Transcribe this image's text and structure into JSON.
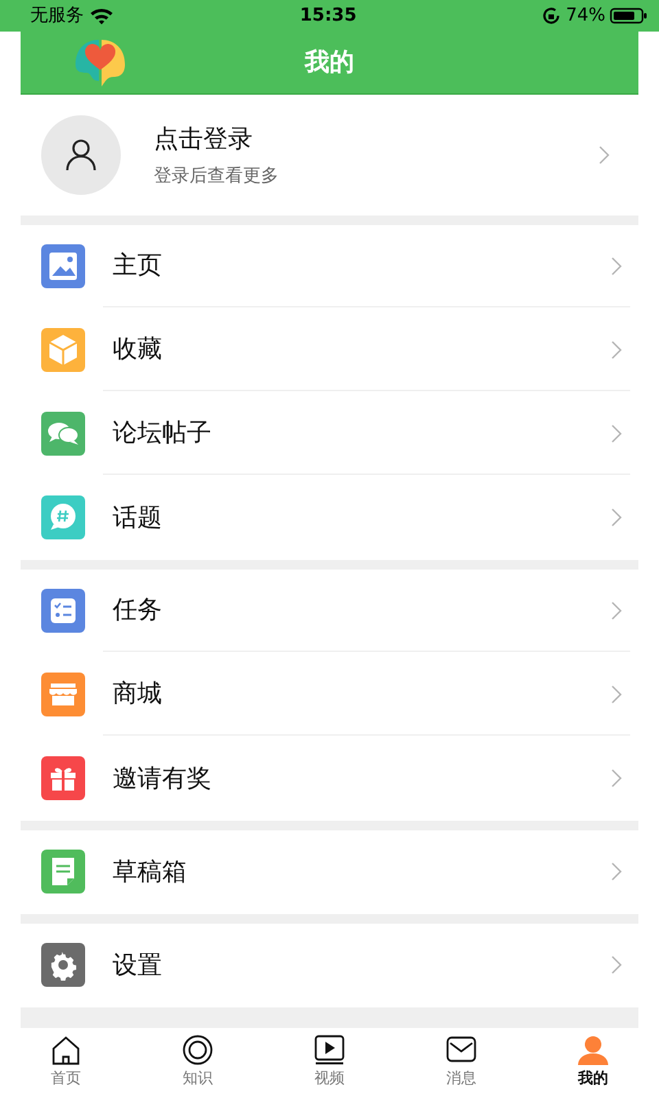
{
  "status_bar": {
    "carrier": "无服务",
    "time": "15:35",
    "battery": "74%"
  },
  "header": {
    "title": "我的"
  },
  "profile": {
    "title": "点击登录",
    "subtitle": "登录后查看更多"
  },
  "menu_sections": [
    [
      {
        "label": "主页",
        "color": "#5b86e0"
      },
      {
        "label": "收藏",
        "color": "#fdb23c"
      },
      {
        "label": "论坛帖子",
        "color": "#4db66a"
      },
      {
        "label": "话题",
        "color": "#3ccdc3"
      }
    ],
    [
      {
        "label": "任务",
        "color": "#5b86e0"
      },
      {
        "label": "商城",
        "color": "#fd8d34"
      },
      {
        "label": "邀请有奖",
        "color": "#f6474a"
      }
    ],
    [
      {
        "label": "草稿箱",
        "color": "#50bc5c"
      }
    ],
    [
      {
        "label": "设置",
        "color": "#6b6b6b"
      }
    ]
  ],
  "tabs": [
    {
      "label": "首页",
      "selected": false
    },
    {
      "label": "知识",
      "selected": false
    },
    {
      "label": "视频",
      "selected": false
    },
    {
      "label": "消息",
      "selected": false
    },
    {
      "label": "我的",
      "selected": true
    }
  ]
}
